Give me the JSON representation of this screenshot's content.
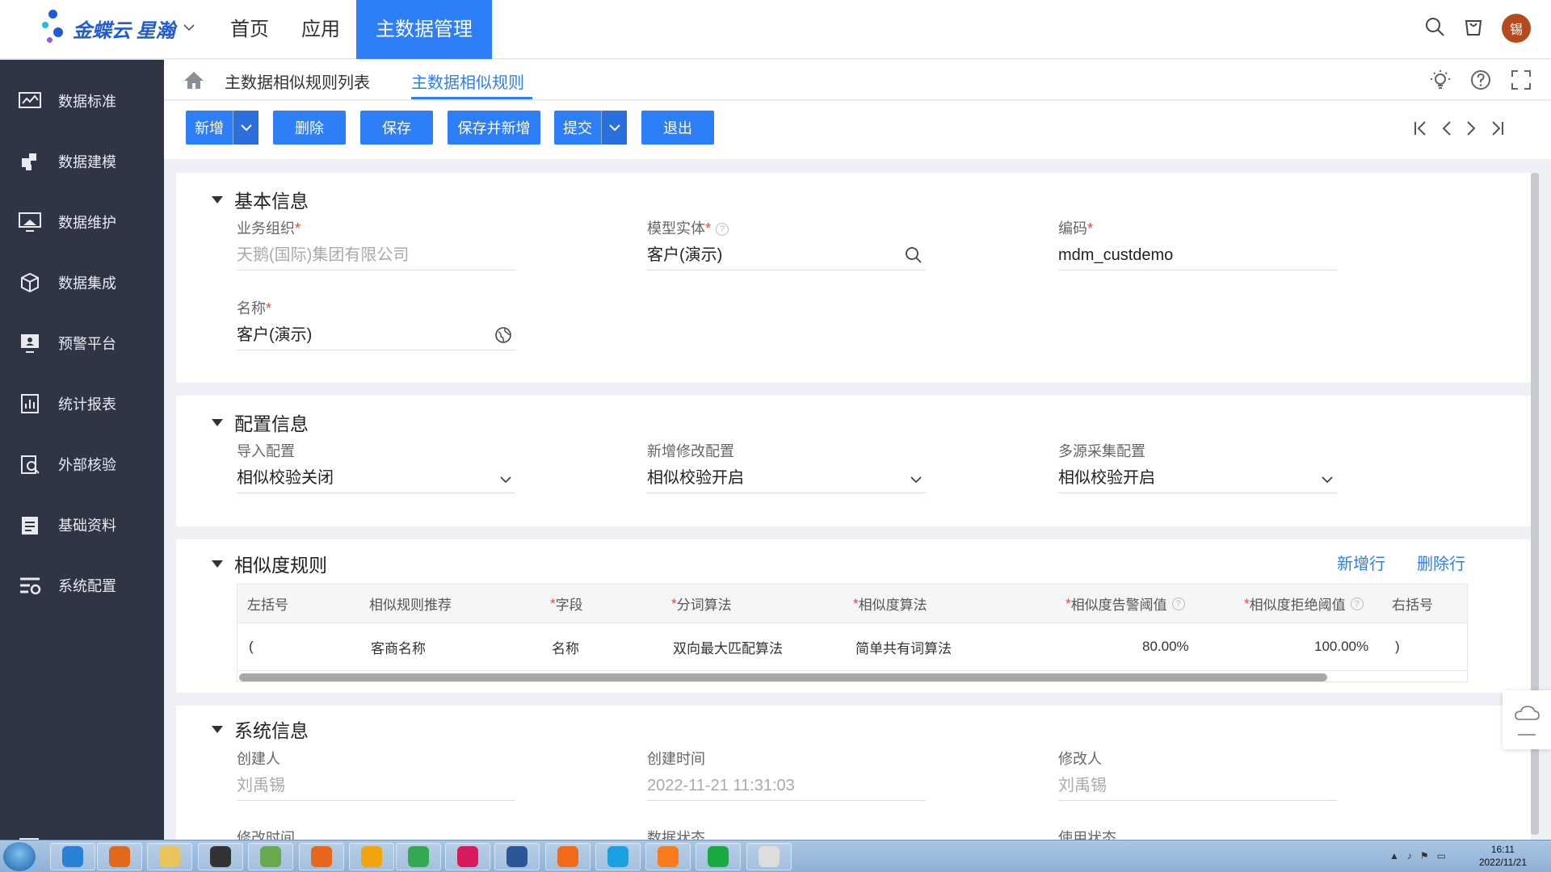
{
  "brand": {
    "name": "金蝶云 星瀚"
  },
  "topnav": [
    {
      "label": "首页",
      "active": false
    },
    {
      "label": "应用",
      "active": false
    },
    {
      "label": "主数据管理",
      "active": true
    }
  ],
  "user": {
    "avatar_text": "锡"
  },
  "sidebar": {
    "items": [
      {
        "label": "数据标准",
        "icon": "chart-monitor-icon"
      },
      {
        "label": "数据建模",
        "icon": "puzzle-icon"
      },
      {
        "label": "数据维护",
        "icon": "monitor-icon"
      },
      {
        "label": "数据集成",
        "icon": "cube-icon"
      },
      {
        "label": "预警平台",
        "icon": "alert-screen-icon"
      },
      {
        "label": "统计报表",
        "icon": "report-icon"
      },
      {
        "label": "外部核验",
        "icon": "clipboard-search-icon"
      },
      {
        "label": "基础资料",
        "icon": "document-icon"
      },
      {
        "label": "系统配置",
        "icon": "settings-list-icon"
      }
    ]
  },
  "breadcrumb": {
    "items": [
      {
        "label": "主数据相似规则列表",
        "active": false
      },
      {
        "label": "主数据相似规则",
        "active": true
      }
    ]
  },
  "toolbar": {
    "new_label": "新增",
    "delete_label": "删除",
    "save_label": "保存",
    "save_new_label": "保存并新增",
    "submit_label": "提交",
    "exit_label": "退出"
  },
  "basic": {
    "title": "基本信息",
    "org": {
      "label": "业务组织",
      "value": "天鹅(国际)集团有限公司"
    },
    "entity": {
      "label": "模型实体",
      "value": "客户(演示)"
    },
    "code": {
      "label": "编码",
      "value": "mdm_custdemo"
    },
    "name": {
      "label": "名称",
      "value": "客户(演示)"
    }
  },
  "config": {
    "title": "配置信息",
    "import": {
      "label": "导入配置",
      "value": "相似校验关闭"
    },
    "modify": {
      "label": "新增修改配置",
      "value": "相似校验开启"
    },
    "multi": {
      "label": "多源采集配置",
      "value": "相似校验开启"
    }
  },
  "rules": {
    "title": "相似度规则",
    "add_row": "新增行",
    "delete_row": "删除行",
    "columns": [
      "左括号",
      "相似规则推荐",
      "字段",
      "分词算法",
      "相似度算法",
      "相似度告警阈值",
      "相似度拒绝阈值",
      "右括号"
    ],
    "rows": [
      {
        "left": "(",
        "recommend": "客商名称",
        "field": "名称",
        "tokenizer": "双向最大匹配算法",
        "algorithm": "简单共有词算法",
        "warn": "80.00%",
        "reject": "100.00%",
        "right": ")"
      }
    ]
  },
  "system": {
    "title": "系统信息",
    "creator": {
      "label": "创建人",
      "value": "刘禹锡"
    },
    "created": {
      "label": "创建时间",
      "value": "2022-11-21 11:31:03"
    },
    "modifier": {
      "label": "修改人",
      "value": "刘禹锡"
    },
    "modified_label": "修改时间",
    "data_status_label": "数据状态",
    "use_status_label": "使用状态"
  },
  "taskbar": {
    "time": "16:11",
    "date": "2022/11/21",
    "apps": [
      {
        "name": "ie-icon",
        "color": "#2a7fd6"
      },
      {
        "name": "media-player-icon",
        "color": "#e06a1b"
      },
      {
        "name": "file-explorer-icon",
        "color": "#e9c35b"
      },
      {
        "name": "panda-icon",
        "color": "#333333"
      },
      {
        "name": "notepad-icon",
        "color": "#6aa84f"
      },
      {
        "name": "firefox-icon",
        "color": "#e8651e"
      },
      {
        "name": "search-tool-icon",
        "color": "#f0a30a"
      },
      {
        "name": "chrome-icon",
        "color": "#34a853"
      },
      {
        "name": "intellij-icon",
        "color": "#d81b60"
      },
      {
        "name": "word-icon",
        "color": "#2b579a"
      },
      {
        "name": "pen-tool-icon",
        "color": "#f26b1d"
      },
      {
        "name": "cloud-app-icon",
        "color": "#1ba1e2"
      },
      {
        "name": "presentation-icon",
        "color": "#f97b1c"
      },
      {
        "name": "spreadsheet-icon",
        "color": "#1aa843"
      },
      {
        "name": "text-app-icon",
        "color": "#dddddd"
      }
    ]
  }
}
